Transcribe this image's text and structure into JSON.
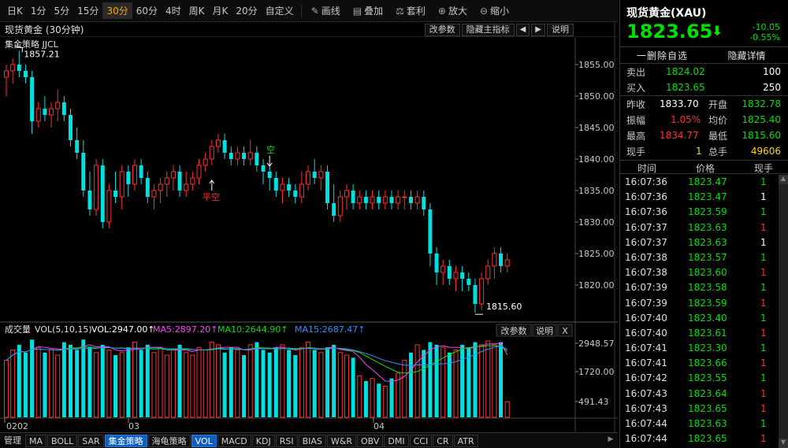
{
  "toolbar": {
    "periods": [
      "日K",
      "1分",
      "5分",
      "15分",
      "30分",
      "60分",
      "4时",
      "周K",
      "月K",
      "20分",
      "自定义"
    ],
    "active_period": "30分",
    "tools": [
      {
        "icon": "pencil-icon",
        "glyph": "✎",
        "label": "画线"
      },
      {
        "icon": "overlay-icon",
        "glyph": "▤",
        "label": "叠加"
      },
      {
        "icon": "arbitrage-icon",
        "glyph": "⚖",
        "label": "套利"
      },
      {
        "icon": "zoom-in-icon",
        "glyph": "⊕",
        "label": "放大"
      },
      {
        "icon": "zoom-out-icon",
        "glyph": "⊖",
        "label": "缩小"
      }
    ],
    "collapse_glyph": "›"
  },
  "chart_header": {
    "title": "现货黄金 (30分钟)",
    "buttons": [
      "改参数",
      "隐藏主指标"
    ],
    "prev_glyph": "◀",
    "next_glyph": "▶",
    "help": "说明"
  },
  "strategy_label": "集金策略 JJCL",
  "price_axis": [
    "1855.00",
    "1850.00",
    "1845.00",
    "1840.00",
    "1835.00",
    "1830.00",
    "1825.00",
    "1820.00"
  ],
  "annotations": {
    "high": "1857.21",
    "low": "1815.60",
    "kong": "空",
    "pingkong": "平空"
  },
  "volume_header": {
    "title": "成交量",
    "vol": "VOL(5,10,15)",
    "vol_val": "VOL:2947.00↑",
    "ma5": "MA5:2897.20↑",
    "ma10": "MA10:2644.90↑",
    "ma15": "MA15:2687.47↑",
    "buttons": [
      "改参数",
      "说明",
      "X"
    ]
  },
  "volume_axis": [
    "2948.57",
    "1720.00",
    "491.43"
  ],
  "date_axis": [
    "0202",
    "03",
    "04"
  ],
  "tabs": [
    "管理",
    "MA",
    "BOLL",
    "SAR",
    "集金策略",
    "海龟策略",
    "VOL",
    "MACD",
    "KDJ",
    "RSI",
    "BIAS",
    "W&R",
    "OBV",
    "DMI",
    "CCI",
    "CR",
    "ATR"
  ],
  "active_tabs": [
    "集金策略",
    "VOL"
  ],
  "quote": {
    "name": "现货黄金(XAU)",
    "price": "1823.65",
    "arrow": "⬇",
    "change": "-10.05",
    "change_pct": "-0.55%",
    "delete_label": "一删除自选",
    "detail_label": "隐藏详情",
    "sell_label": "卖出",
    "sell_price": "1824.02",
    "sell_vol": "100",
    "buy_label": "买入",
    "buy_price": "1823.65",
    "buy_vol": "250",
    "prev_close_label": "昨收",
    "prev_close": "1833.70",
    "open_label": "开盘",
    "open": "1832.78",
    "amp_label": "振幅",
    "amp": "1.05%",
    "avg_label": "均价",
    "avg": "1825.40",
    "high_label": "最高",
    "high": "1834.77",
    "low_label": "最低",
    "low": "1815.60",
    "curvol_label": "现手",
    "curvol": "1",
    "totvol_label": "总手",
    "totvol": "49606"
  },
  "ticks_header": [
    "时间",
    "价格",
    "现手"
  ],
  "ticks": [
    {
      "time": "16:07:36",
      "price": "1823.47",
      "vol": "1",
      "vc": "#00e000"
    },
    {
      "time": "16:07:36",
      "price": "1823.47",
      "vol": "1",
      "vc": "#ffffff"
    },
    {
      "time": "16:07:36",
      "price": "1823.59",
      "vol": "1",
      "vc": "#00e000"
    },
    {
      "time": "16:07:37",
      "price": "1823.63",
      "vol": "1",
      "vc": "#ff3030"
    },
    {
      "time": "16:07:37",
      "price": "1823.63",
      "vol": "1",
      "vc": "#ffffff"
    },
    {
      "time": "16:07:38",
      "price": "1823.57",
      "vol": "1",
      "vc": "#00e000"
    },
    {
      "time": "16:07:38",
      "price": "1823.60",
      "vol": "1",
      "vc": "#ff3030"
    },
    {
      "time": "16:07:39",
      "price": "1823.58",
      "vol": "1",
      "vc": "#00e000"
    },
    {
      "time": "16:07:39",
      "price": "1823.59",
      "vol": "1",
      "vc": "#ff3030"
    },
    {
      "time": "16:07:40",
      "price": "1823.40",
      "vol": "1",
      "vc": "#00e000"
    },
    {
      "time": "16:07:40",
      "price": "1823.61",
      "vol": "1",
      "vc": "#ff3030"
    },
    {
      "time": "16:07:41",
      "price": "1823.30",
      "vol": "1",
      "vc": "#00e000"
    },
    {
      "time": "16:07:41",
      "price": "1823.66",
      "vol": "1",
      "vc": "#ff3030"
    },
    {
      "time": "16:07:42",
      "price": "1823.55",
      "vol": "1",
      "vc": "#00e000"
    },
    {
      "time": "16:07:43",
      "price": "1823.64",
      "vol": "1",
      "vc": "#ff3030"
    },
    {
      "time": "16:07:43",
      "price": "1823.65",
      "vol": "1",
      "vc": "#ff3030"
    },
    {
      "time": "16:07:44",
      "price": "1823.63",
      "vol": "1",
      "vc": "#00e000"
    },
    {
      "time": "16:07:44",
      "price": "1823.65",
      "vol": "1",
      "vc": "#ff3030"
    }
  ],
  "colors": {
    "up": "#ff3030",
    "down": "#00e0e0",
    "green": "#00e000",
    "yellow": "#ffd700"
  },
  "chart_data": {
    "type": "candlestick",
    "price_range": [
      1815,
      1858
    ],
    "candles": [
      [
        1853,
        1855,
        1850,
        1854
      ],
      [
        1854,
        1856,
        1852,
        1855
      ],
      [
        1855,
        1857.21,
        1853,
        1854
      ],
      [
        1854,
        1855,
        1852,
        1853
      ],
      [
        1853,
        1854,
        1844,
        1846
      ],
      [
        1846,
        1849,
        1845,
        1848
      ],
      [
        1848,
        1850,
        1846,
        1847
      ],
      [
        1847,
        1849,
        1845,
        1848
      ],
      [
        1848,
        1851,
        1846,
        1849
      ],
      [
        1849,
        1850,
        1846,
        1847
      ],
      [
        1847,
        1848,
        1842,
        1843
      ],
      [
        1843,
        1845,
        1840,
        1841
      ],
      [
        1841,
        1843,
        1834,
        1835
      ],
      [
        1835,
        1838,
        1831,
        1832
      ],
      [
        1832,
        1840,
        1831,
        1839
      ],
      [
        1839,
        1840,
        1829,
        1830
      ],
      [
        1830,
        1836,
        1829,
        1835
      ],
      [
        1835,
        1838,
        1833,
        1834
      ],
      [
        1834,
        1839,
        1832,
        1838
      ],
      [
        1838,
        1839,
        1834,
        1836
      ],
      [
        1836,
        1840,
        1835,
        1839
      ],
      [
        1839,
        1840,
        1836,
        1837
      ],
      [
        1837,
        1838,
        1833,
        1834
      ],
      [
        1834,
        1836,
        1832,
        1835
      ],
      [
        1835,
        1837,
        1833,
        1836
      ],
      [
        1836,
        1838,
        1834,
        1837
      ],
      [
        1837,
        1839,
        1835,
        1838
      ],
      [
        1838,
        1839,
        1834,
        1835
      ],
      [
        1835,
        1838,
        1834,
        1836
      ],
      [
        1836,
        1838,
        1835,
        1837
      ],
      [
        1837,
        1840,
        1836,
        1839
      ],
      [
        1839,
        1841,
        1838,
        1840
      ],
      [
        1840,
        1843,
        1839,
        1842
      ],
      [
        1842,
        1844,
        1841,
        1843
      ],
      [
        1843,
        1844,
        1840,
        1841
      ],
      [
        1841,
        1842,
        1839,
        1840
      ],
      [
        1840,
        1842,
        1839,
        1841
      ],
      [
        1841,
        1842,
        1839,
        1840
      ],
      [
        1840,
        1843,
        1839,
        1841
      ],
      [
        1841,
        1842,
        1838,
        1839
      ],
      [
        1839,
        1840,
        1836,
        1838
      ],
      [
        1838,
        1839,
        1835,
        1837
      ],
      [
        1837,
        1838,
        1834,
        1835
      ],
      [
        1835,
        1837,
        1833,
        1836
      ],
      [
        1836,
        1837,
        1834,
        1835
      ],
      [
        1835,
        1836,
        1833,
        1834
      ],
      [
        1834,
        1838,
        1833,
        1836
      ],
      [
        1836,
        1839,
        1835,
        1838
      ],
      [
        1838,
        1840,
        1836,
        1837
      ],
      [
        1837,
        1839,
        1835,
        1838
      ],
      [
        1838,
        1839,
        1832,
        1833
      ],
      [
        1833,
        1836,
        1830,
        1831
      ],
      [
        1831,
        1835,
        1830,
        1834
      ],
      [
        1834,
        1836,
        1832,
        1835
      ],
      [
        1835,
        1836,
        1832,
        1833
      ],
      [
        1833,
        1835,
        1832,
        1834
      ],
      [
        1834,
        1835,
        1832,
        1833
      ],
      [
        1833,
        1835,
        1832,
        1834
      ],
      [
        1834,
        1835,
        1832,
        1833
      ],
      [
        1833,
        1835,
        1832,
        1834
      ],
      [
        1834,
        1835,
        1832,
        1833
      ],
      [
        1833,
        1835,
        1832,
        1834
      ],
      [
        1834,
        1835,
        1832,
        1834
      ],
      [
        1834,
        1835,
        1832,
        1833
      ],
      [
        1833,
        1835,
        1832,
        1834
      ],
      [
        1834,
        1835,
        1831,
        1832
      ],
      [
        1832,
        1833,
        1823,
        1825
      ],
      [
        1825,
        1826,
        1820,
        1822
      ],
      [
        1822,
        1824,
        1820,
        1823
      ],
      [
        1823,
        1824,
        1820,
        1821
      ],
      [
        1821,
        1823,
        1819,
        1822
      ],
      [
        1822,
        1823,
        1819,
        1821
      ],
      [
        1821,
        1822,
        1819,
        1820
      ],
      [
        1820,
        1821,
        1815.6,
        1817
      ],
      [
        1817,
        1822,
        1816,
        1821
      ],
      [
        1821,
        1824,
        1820,
        1823
      ],
      [
        1823,
        1826,
        1821,
        1825
      ],
      [
        1825,
        1826,
        1822,
        1823
      ],
      [
        1823,
        1825,
        1822,
        1824
      ]
    ],
    "volumes": [
      2200,
      2600,
      2800,
      2500,
      3000,
      2700,
      2500,
      2600,
      2400,
      2900,
      2800,
      2600,
      3000,
      2700,
      2500,
      2800,
      2600,
      2400,
      2500,
      2700,
      2900,
      2600,
      2800,
      2500,
      2700,
      2400,
      2600,
      2800,
      2500,
      2400,
      2700,
      2600,
      2900,
      2800,
      2500,
      2700,
      2600,
      2400,
      2800,
      2900,
      2600,
      2500,
      2700,
      2800,
      2600,
      2400,
      2700,
      2900,
      2600,
      2500,
      2700,
      2800,
      2500,
      2400,
      2300,
      1600,
      1400,
      1500,
      1300,
      1200,
      1500,
      1700,
      2200,
      2500,
      2800,
      2600,
      2900,
      2800,
      2700,
      2500,
      2600,
      2800,
      2700,
      2900,
      2800,
      2947,
      2800,
      2900,
      600
    ],
    "vol_range": [
      0,
      3100
    ]
  }
}
